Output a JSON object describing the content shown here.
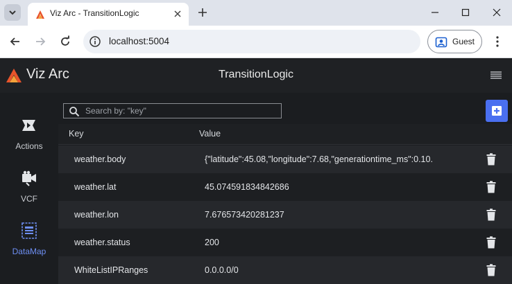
{
  "browser": {
    "tab_title": "Viz Arc - TransitionLogic",
    "url": "localhost:5004",
    "profile_label": "Guest"
  },
  "app": {
    "brand": "Viz Arc",
    "title": "TransitionLogic",
    "accent_color": "#4a6ff0"
  },
  "sidebar": {
    "items": [
      {
        "label": "Actions",
        "icon": "actions-icon",
        "active": false
      },
      {
        "label": "VCF",
        "icon": "vcf-icon",
        "active": false
      },
      {
        "label": "DataMap",
        "icon": "datamap-icon",
        "active": true
      }
    ]
  },
  "search": {
    "placeholder": "Search by: \"key\"",
    "value": ""
  },
  "table": {
    "columns": [
      "Key",
      "Value"
    ],
    "rows": [
      {
        "key": "weather.body",
        "value": "{\"latitude\":45.08,\"longitude\":7.68,\"generationtime_ms\":0.10."
      },
      {
        "key": "weather.lat",
        "value": "45.074591834842686"
      },
      {
        "key": "weather.lon",
        "value": "7.676573420281237"
      },
      {
        "key": "weather.status",
        "value": "200"
      },
      {
        "key": "WhiteListIPRanges",
        "value": "0.0.0.0/0"
      }
    ]
  }
}
